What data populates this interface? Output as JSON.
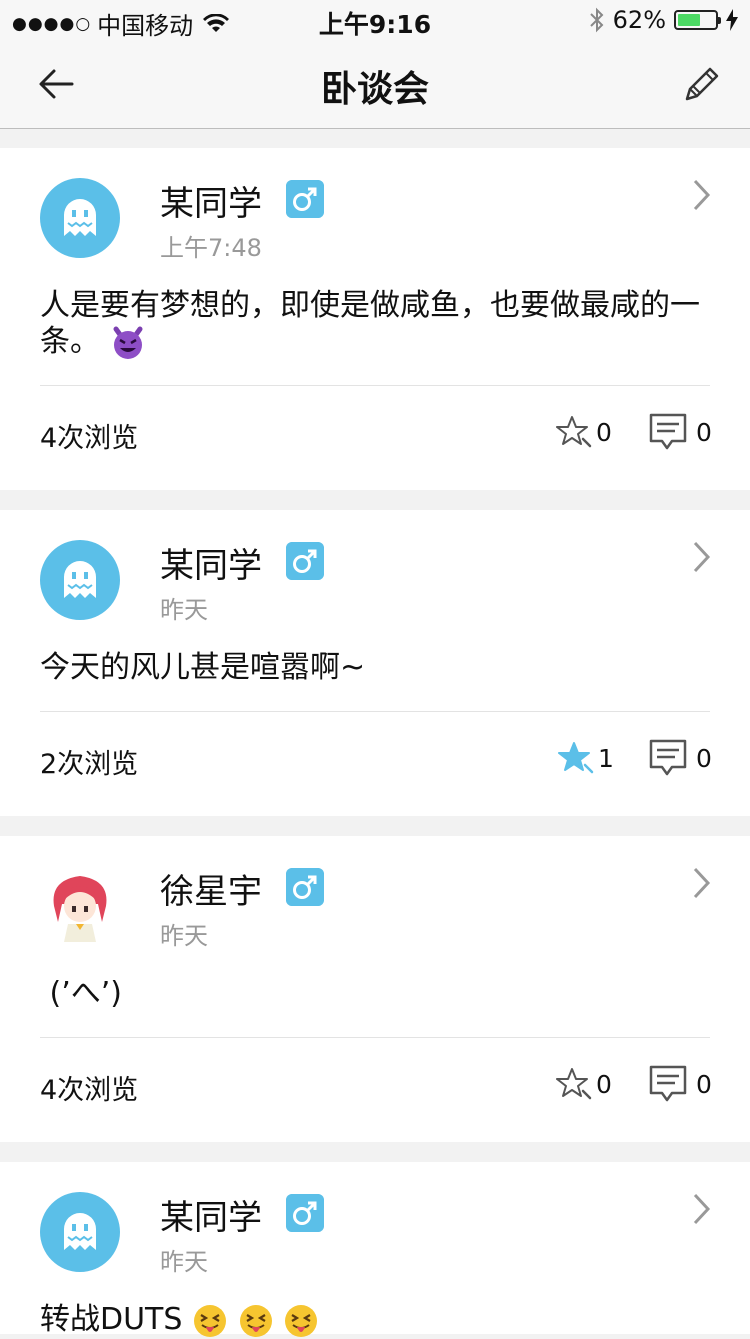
{
  "status_bar": {
    "signal": "●●●●○",
    "carrier": "中国移动",
    "time": "上午9:16",
    "battery": "62%",
    "battery_level": 0.62
  },
  "nav": {
    "title": "卧谈会"
  },
  "posts": [
    {
      "name": "某同学",
      "gender_icon": "male-symbol",
      "time": "上午7:48",
      "content": "人是要有梦想的，即使是做咸鱼，也要做最咸的一条。",
      "content_emoji": "smiling-devil-emoji",
      "views": "4次浏览",
      "likes": "0",
      "comments": "0",
      "liked": false
    },
    {
      "name": "某同学",
      "gender_icon": "male-symbol",
      "time": "昨天",
      "content": "今天的风儿甚是喧嚣啊~",
      "views": "2次浏览",
      "likes": "1",
      "comments": "0",
      "liked": true
    },
    {
      "name": "徐星宇",
      "gender_icon": "male-symbol",
      "time": "昨天",
      "content": " (’へ’)",
      "views": "4次浏览",
      "likes": "0",
      "comments": "0",
      "liked": false
    },
    {
      "name": "某同学",
      "gender_icon": "male-symbol",
      "time": "昨天",
      "content": "转战DUTS",
      "content_emoji": "tongue-squint-emoji"
    }
  ],
  "colors": {
    "accent": "#5bbfe8",
    "battery": "#4cd964"
  }
}
